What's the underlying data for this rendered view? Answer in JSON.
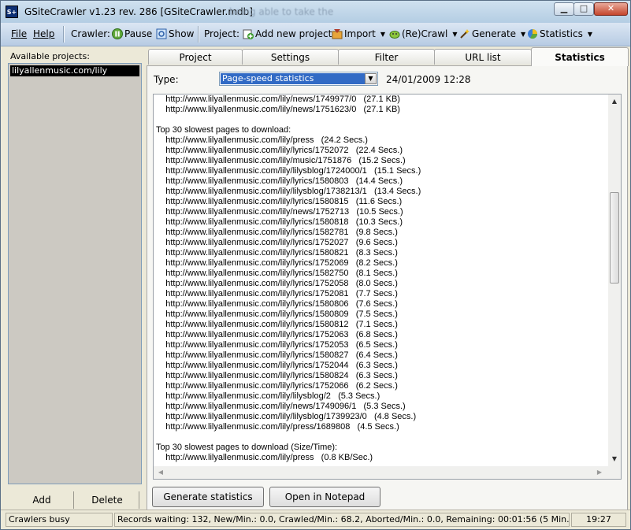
{
  "window": {
    "title": "GSiteCrawler v1.23 rev. 286 [GSiteCrawler.mdb]",
    "ghost_title": "being able to take the"
  },
  "menu": {
    "file": "File",
    "help": "Help",
    "crawler_label": "Crawler:",
    "pause": "Pause",
    "show": "Show",
    "project_label": "Project:",
    "add_new_project": "Add new project",
    "import": "Import",
    "recrawl": "(Re)Crawl",
    "generate": "Generate",
    "statistics": "Statistics"
  },
  "sidebar": {
    "label": "Available projects:",
    "projects": [
      "lilyallenmusic.com/lily"
    ],
    "add_label": "Add",
    "delete_label": "Delete"
  },
  "tabs": [
    "Project",
    "Settings",
    "Filter",
    "URL list",
    "Statistics"
  ],
  "active_tab": "Statistics",
  "stats": {
    "type_label": "Type:",
    "type_value": "Page-speed statistics",
    "datetime": "24/01/2009  12:28",
    "report_lines": [
      "    http://www.lilyallenmusic.com/lily/news/1749977/0   (27.1 KB)",
      "    http://www.lilyallenmusic.com/lily/news/1751623/0   (27.1 KB)",
      "",
      "Top 30 slowest pages to download:",
      "    http://www.lilyallenmusic.com/lily/press   (24.2 Secs.)",
      "    http://www.lilyallenmusic.com/lily/lyrics/1752072   (22.4 Secs.)",
      "    http://www.lilyallenmusic.com/lily/music/1751876   (15.2 Secs.)",
      "    http://www.lilyallenmusic.com/lily/lilysblog/1724000/1   (15.1 Secs.)",
      "    http://www.lilyallenmusic.com/lily/lyrics/1580803   (14.4 Secs.)",
      "    http://www.lilyallenmusic.com/lily/lilysblog/1738213/1   (13.4 Secs.)",
      "    http://www.lilyallenmusic.com/lily/lyrics/1580815   (11.6 Secs.)",
      "    http://www.lilyallenmusic.com/lily/news/1752713   (10.5 Secs.)",
      "    http://www.lilyallenmusic.com/lily/lyrics/1580818   (10.3 Secs.)",
      "    http://www.lilyallenmusic.com/lily/lyrics/1582781   (9.8 Secs.)",
      "    http://www.lilyallenmusic.com/lily/lyrics/1752027   (9.6 Secs.)",
      "    http://www.lilyallenmusic.com/lily/lyrics/1580821   (8.3 Secs.)",
      "    http://www.lilyallenmusic.com/lily/lyrics/1752069   (8.2 Secs.)",
      "    http://www.lilyallenmusic.com/lily/lyrics/1582750   (8.1 Secs.)",
      "    http://www.lilyallenmusic.com/lily/lyrics/1752058   (8.0 Secs.)",
      "    http://www.lilyallenmusic.com/lily/lyrics/1752081   (7.7 Secs.)",
      "    http://www.lilyallenmusic.com/lily/lyrics/1580806   (7.6 Secs.)",
      "    http://www.lilyallenmusic.com/lily/lyrics/1580809   (7.5 Secs.)",
      "    http://www.lilyallenmusic.com/lily/lyrics/1580812   (7.1 Secs.)",
      "    http://www.lilyallenmusic.com/lily/lyrics/1752063   (6.8 Secs.)",
      "    http://www.lilyallenmusic.com/lily/lyrics/1752053   (6.5 Secs.)",
      "    http://www.lilyallenmusic.com/lily/lyrics/1580827   (6.4 Secs.)",
      "    http://www.lilyallenmusic.com/lily/lyrics/1752044   (6.3 Secs.)",
      "    http://www.lilyallenmusic.com/lily/lyrics/1580824   (6.3 Secs.)",
      "    http://www.lilyallenmusic.com/lily/lyrics/1752066   (6.2 Secs.)",
      "    http://www.lilyallenmusic.com/lily/lilysblog/2   (5.3 Secs.)",
      "    http://www.lilyallenmusic.com/lily/news/1749096/1   (5.3 Secs.)",
      "    http://www.lilyallenmusic.com/lily/lilysblog/1739923/0   (4.8 Secs.)",
      "    http://www.lilyallenmusic.com/lily/press/1689808   (4.5 Secs.)",
      "",
      "Top 30 slowest pages to download (Size/Time):",
      "    http://www.lilyallenmusic.com/lily/press   (0.8 KB/Sec.)"
    ],
    "generate_button": "Generate statistics",
    "notepad_button": "Open in Notepad"
  },
  "statusbar": {
    "state": "Crawlers busy",
    "records": "Records waiting: 132, New/Min.: 0.0, Crawled/Min.: 68.2, Aborted/Min.: 0.0, Remaining: 00:01:56 (5 Min. avg)",
    "time": "19:27"
  },
  "colors": {
    "selection": "#316ac5",
    "menubar": "#c8d9ec",
    "close_button": "#c4452c"
  }
}
